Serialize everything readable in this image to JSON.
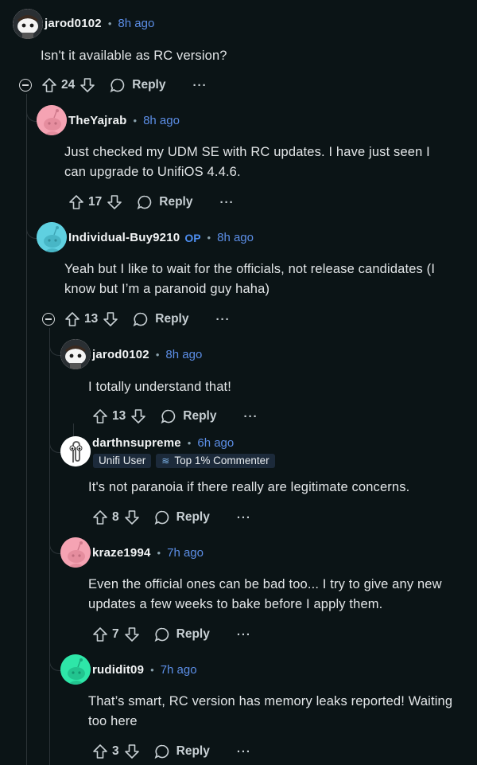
{
  "comments": [
    {
      "username": "jarod0102",
      "time": "8h ago",
      "body": "Isn't it available as RC version?",
      "score": "24",
      "reply": "Reply",
      "more": "···",
      "op": ""
    },
    {
      "username": "TheYajrab",
      "time": "8h ago",
      "body": "Just checked my UDM SE with RC updates. I have just seen I can upgrade to UnifiOS 4.4.6.",
      "score": "17",
      "reply": "Reply",
      "more": "···",
      "op": ""
    },
    {
      "username": "Individual-Buy9210",
      "time": "8h ago",
      "body": "Yeah but I like to wait for the officials, not release candidates (I know but I’m a paranoid guy haha)",
      "score": "13",
      "reply": "Reply",
      "more": "···",
      "op": "OP"
    },
    {
      "username": "jarod0102",
      "time": "8h ago",
      "body": "I totally understand that!",
      "score": "13",
      "reply": "Reply",
      "more": "···",
      "op": ""
    },
    {
      "username": "darthnsupreme",
      "time": "6h ago",
      "body": "It's not paranoia if there really are legitimate concerns.",
      "score": "8",
      "reply": "Reply",
      "more": "···",
      "op": "",
      "flairs": [
        "Unifi User",
        "Top 1% Commenter"
      ]
    },
    {
      "username": "kraze1994",
      "time": "7h ago",
      "body": "Even the official ones can be bad too... I try to give any new updates a few weeks to bake before I apply them.",
      "score": "7",
      "reply": "Reply",
      "more": "···",
      "op": ""
    },
    {
      "username": "rudidit09",
      "time": "7h ago",
      "body": "That’s smart, RC version has memory leaks reported! Waiting too here",
      "score": "3",
      "reply": "Reply",
      "more": "···",
      "op": ""
    }
  ],
  "colors": {
    "background": "#0b1416",
    "time": "#5c8ee6",
    "op": "#4d8ef0",
    "thread_line": "#2c3438"
  },
  "meta_separator": "•"
}
